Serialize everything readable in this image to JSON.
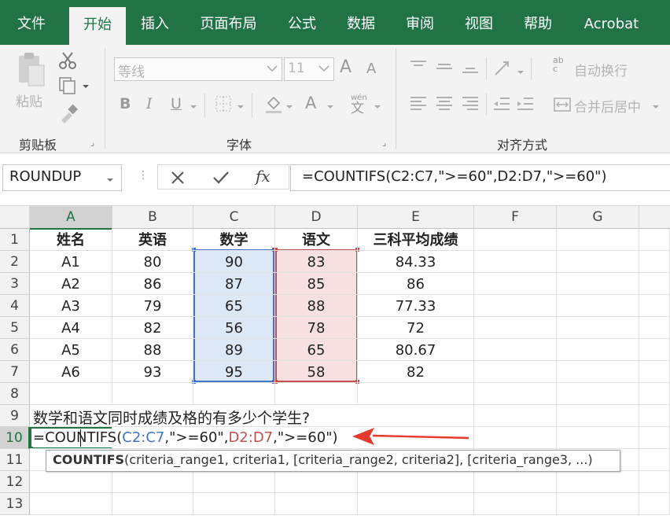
{
  "tabs": [
    "文件",
    "开始",
    "插入",
    "页面布局",
    "公式",
    "数据",
    "审阅",
    "视图",
    "帮助",
    "Acrobat"
  ],
  "active_tab": "开始",
  "ribbon": {
    "clipboard": {
      "paste_label": "粘贴",
      "group_label": "剪贴板"
    },
    "font": {
      "font_name": "等线",
      "font_size": "11",
      "group_label": "字体",
      "grow": "A",
      "shrink": "A",
      "bold": "B",
      "italic": "I",
      "underline": "U",
      "font_color": "A",
      "phonetic_top": "wén",
      "phonetic_bottom": "文"
    },
    "alignment": {
      "wrap_text": "自动换行",
      "merge_center": "合并后居中",
      "group_label": "对齐方式",
      "wrap_icon_top": "ab",
      "wrap_icon_bottom": "c"
    }
  },
  "formula_bar": {
    "name_box": "ROUNDUP",
    "fx": "fx",
    "formula": "=COUNTIFS(C2:C7,\">=60\",D2:D7,\">=60\")"
  },
  "columns": [
    "A",
    "B",
    "C",
    "D",
    "E",
    "F",
    "G"
  ],
  "rows": [
    "1",
    "2",
    "3",
    "4",
    "5",
    "6",
    "7",
    "8",
    "9",
    "10",
    "11",
    "12",
    "13"
  ],
  "table": {
    "header": [
      "姓名",
      "英语",
      "数学",
      "语文",
      "三科平均成绩"
    ],
    "data": [
      [
        "A1",
        "80",
        "90",
        "83",
        "84.33"
      ],
      [
        "A2",
        "86",
        "87",
        "85",
        "86"
      ],
      [
        "A3",
        "79",
        "65",
        "88",
        "77.33"
      ],
      [
        "A4",
        "82",
        "56",
        "78",
        "72"
      ],
      [
        "A5",
        "88",
        "89",
        "65",
        "80.67"
      ],
      [
        "A6",
        "93",
        "95",
        "58",
        "82"
      ]
    ]
  },
  "question": "数学和语文同时成绩及格的有多少个学生?",
  "edit_cell": {
    "part1": "=COUNTIFS(",
    "range1": "C2:C7",
    "part2": ",\">=60\",",
    "range2": "D2:D7",
    "part3": ",\">=60\")"
  },
  "tooltip": {
    "fn": "COUNTIFS",
    "args": "(criteria_range1, criteria1, [criteria_range2, criteria2], [criteria_range3, ...)"
  },
  "colors": {
    "ribbon_green": "#217346",
    "range1_blue": "#4472c4",
    "range2_red": "#c0504d",
    "arrow_red": "#e8392f"
  }
}
